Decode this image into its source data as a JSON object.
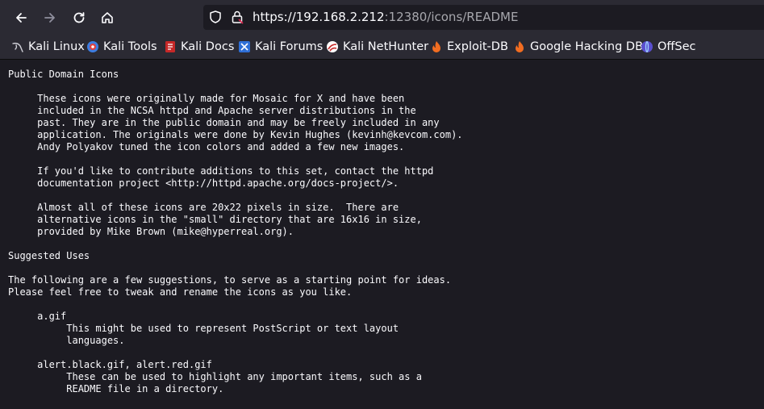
{
  "browser": {
    "url_host": "https://192.168.2.212",
    "url_rest": ":12380/icons/README",
    "icons": [
      "back-arrow-icon",
      "forward-arrow-icon",
      "reload-icon",
      "home-icon",
      "shield-icon",
      "lock-icon"
    ]
  },
  "bookmarks": [
    {
      "label": "Kali Linux",
      "icon": "kali-dragon-icon"
    },
    {
      "label": "Kali Tools",
      "icon": "kali-tools-icon"
    },
    {
      "label": "Kali Docs",
      "icon": "kali-docs-icon"
    },
    {
      "label": "Kali Forums",
      "icon": "kali-forums-icon"
    },
    {
      "label": "Kali NetHunter",
      "icon": "nethunter-icon"
    },
    {
      "label": "Exploit-DB",
      "icon": "exploit-db-icon"
    },
    {
      "label": "Google Hacking DB",
      "icon": "ghdb-icon"
    },
    {
      "label": "OffSec",
      "icon": "offsec-icon"
    }
  ],
  "document": {
    "text": "Public Domain Icons\n\n     These icons were originally made for Mosaic for X and have been\n     included in the NCSA httpd and Apache server distributions in the\n     past. They are in the public domain and may be freely included in any\n     application. The originals were done by Kevin Hughes (kevinh@kevcom.com).\n     Andy Polyakov tuned the icon colors and added a few new images.\n\n     If you'd like to contribute additions to this set, contact the httpd\n     documentation project <http://httpd.apache.org/docs-project/>.\n\n     Almost all of these icons are 20x22 pixels in size.  There are\n     alternative icons in the \"small\" directory that are 16x16 in size,\n     provided by Mike Brown (mike@hyperreal.org).\n\nSuggested Uses\n\nThe following are a few suggestions, to serve as a starting point for ideas.\nPlease feel free to tweak and rename the icons as you like.\n\n     a.gif\n          This might be used to represent PostScript or text layout\n          languages.\n\n     alert.black.gif, alert.red.gif\n          These can be used to highlight any important items, such as a\n          README file in a directory."
  }
}
